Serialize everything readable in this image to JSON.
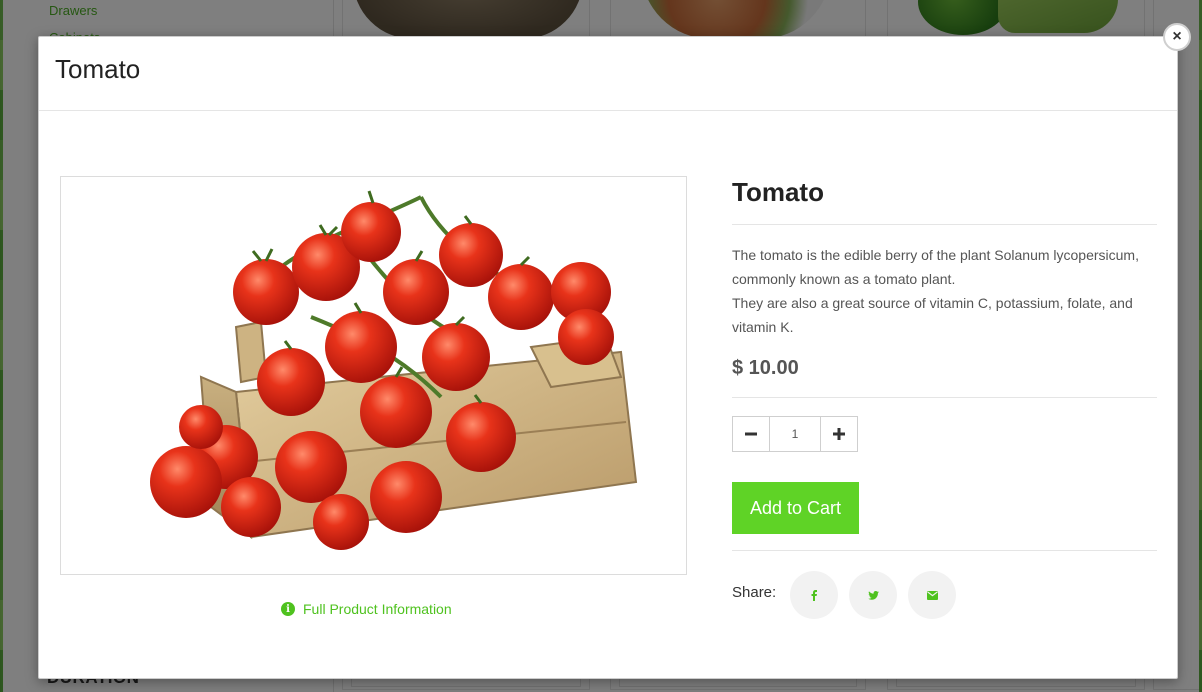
{
  "background": {
    "sidebar_links": [
      "Drawers",
      "Cabinets"
    ],
    "sidebar_heading": "DURATION"
  },
  "modal": {
    "header_title": "Tomato",
    "close_glyph": "×",
    "image_alt": "Tomato",
    "full_info_label": "Full Product Information",
    "product": {
      "title": "Tomato",
      "description_lines": [
        "The tomato is the edible berry of the plant Solanum lycopersicum, commonly known as a tomato plant.",
        "They are also a great source of vitamin C, potassium, folate, and vitamin K."
      ],
      "price": "$ 10.00",
      "quantity": "1",
      "add_to_cart_label": "Add to Cart",
      "share_label": "Share:",
      "share_icons": [
        "facebook-icon",
        "twitter-icon",
        "envelope-icon"
      ]
    }
  },
  "colors": {
    "accent_green": "#5fd326",
    "link_green": "#4fc21f",
    "overlay": "rgba(0,0,0,0.5)"
  }
}
